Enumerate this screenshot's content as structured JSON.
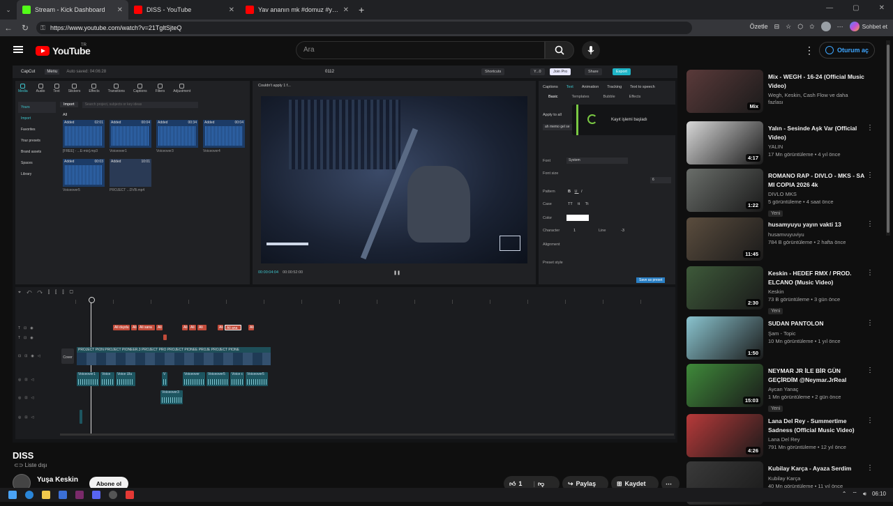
{
  "browser": {
    "tabs": [
      {
        "title": "Stream - Kick Dashboard",
        "icon": "kick-icon",
        "color": "#53fc18",
        "active": true
      },
      {
        "title": "DISS - YouTube",
        "icon": "youtube-icon",
        "color": "#ff0000",
        "active": false
      },
      {
        "title": "Yav ananın mk #domuz #yaw #ana",
        "icon": "youtube-icon",
        "color": "#ff0000",
        "active": false
      }
    ],
    "url": "https://www.youtube.com/watch?v=21TgltSjteQ",
    "summarize_label": "Özetle",
    "chat_label": "Sohbet et"
  },
  "youtube": {
    "logo_text": "YouTube",
    "region": "TR",
    "search_placeholder": "Ara",
    "signin_label": "Oturum aç"
  },
  "capcut": {
    "app_name": "CapCut",
    "menu_label": "Menu",
    "autosave": "Auto saved: 04:06:28",
    "project_name": "0112",
    "shortcuts": "Shortcuts",
    "user": "Y...0",
    "join_pro": "Join Pro",
    "share": "Share",
    "export": "Export",
    "toolbar": [
      "Media",
      "Audio",
      "Text",
      "Stickers",
      "Effects",
      "Transitions",
      "Captions",
      "Filters",
      "Adjustment"
    ],
    "sidebar": [
      "Yours",
      "Import",
      "Favorites",
      "Your presets",
      "Brand assets",
      "Spaces",
      "Library"
    ],
    "import_label": "Import",
    "search_placeholder": "Search project, subjects or key ideas",
    "all_label": "All",
    "media": [
      {
        "label": "Added",
        "duration": "02:01",
        "name": "[FREE] - ...E-mix].mp3"
      },
      {
        "label": "Added",
        "duration": "00:04",
        "name": "Voiceover1"
      },
      {
        "label": "Added",
        "duration": "00:34",
        "name": "Voiceover3"
      },
      {
        "label": "Added",
        "duration": "00:04",
        "name": "Voiceover4"
      },
      {
        "label": "Added",
        "duration": "00:03",
        "name": "Voiceover5"
      },
      {
        "label": "Added",
        "duration": "10:01",
        "name": "PROJECT ...DVB.mp4"
      }
    ],
    "preview_status": "Couldn't apply 1 f...",
    "time_current": "00:00:04:04",
    "time_total": "00:00:52:00",
    "props_tabs": [
      "Captions",
      "Text",
      "Animation",
      "Tracking",
      "Text to speech"
    ],
    "props_sub": [
      "Basic",
      "Templates",
      "Bubble",
      "Effects"
    ],
    "apply_all": "Apply to all",
    "text_sample": "ah memo gel se",
    "font_label": "Font",
    "font_value": "System",
    "fontsize_label": "Font size",
    "fontsize_value": "6",
    "pattern_label": "Pattern",
    "pattern_opts": [
      "B",
      "U",
      "I"
    ],
    "case_label": "Case",
    "case_opts": [
      "TT",
      "tt",
      "Tt"
    ],
    "color_label": "Color",
    "character_label": "Character",
    "character_value": "1",
    "line_label": "Line",
    "line_value": "-3",
    "alignment_label": "Alignment",
    "preset_label": "Preset style",
    "save_preset": "Save as preset",
    "toast": "Kayıt işlemi başladı",
    "text_clips": [
      "Ali duydu",
      "Ali",
      "Ali sana",
      "Ali",
      "Ali",
      "Ali",
      "Ali",
      "Ali",
      "Ali ana",
      "Ali"
    ],
    "video_clip_labels": "PROJECT PION  PROJECT PIONEER.3  PROJECT PRO  PROJECT PIONEE  PROJE  PROJECT PIONE",
    "audio_clips": [
      "Voiceover1",
      "Voice",
      "Voice Ulu",
      "V",
      "Voiceover",
      "Voiceover5",
      "Voice c",
      "Voiceover5"
    ],
    "audio_clip2": "Voiceover3",
    "cover_label": "Cover"
  },
  "video": {
    "title": "DISS",
    "visibility": "Liste dışı",
    "channel": "Yuşa Keskin",
    "subscribe": "Abone ol",
    "likes": "1",
    "share": "Paylaş",
    "save": "Kaydet"
  },
  "recommendations": [
    {
      "title": "Mix - WEGH - 16-24 (Official Music Video)",
      "meta1": "Wegh, Keskin, Cash Flow ve daha fazlası",
      "meta2": "",
      "badge": "Mix",
      "new": false,
      "thumb": "#5a3a3a"
    },
    {
      "title": "Yalın - Sesinde Aşk Var (Official Video)",
      "meta1": "YALIN",
      "meta2": "17 Mn görüntüleme • 4 yıl önce",
      "badge": "4:17",
      "new": false,
      "thumb": "#d8d8d8"
    },
    {
      "title": "ROMANO RAP - DIVLO - MKS - SA MI COPIA 2026 4k",
      "meta1": "DIVLO MKS",
      "meta2": "5 görüntüleme • 4 saat önce",
      "badge": "1:22",
      "new": true,
      "thumb": "#6a6e6a"
    },
    {
      "title": "husamyuyu yayın vakti 13",
      "meta1": "husamvuyuviyu",
      "meta2": "784 B görüntüleme • 2 hafta önce",
      "badge": "11:45",
      "new": false,
      "thumb": "#5b4d3e"
    },
    {
      "title": "Keskin - HEDEF RMX / PROD. ELCANO (Music Video)",
      "meta1": "Keskin",
      "meta2": "73 B görüntüleme • 3 gün önce",
      "badge": "2:30",
      "new": true,
      "thumb": "#3e5a3a"
    },
    {
      "title": "SUDAN PANTOLON",
      "meta1": "Şam - Topic",
      "meta2": "10 Mn görüntüleme • 1 yıl önce",
      "badge": "1:50",
      "new": false,
      "thumb": "#8ac4cf"
    },
    {
      "title": "NEYMAR JR İLE BİR GÜN GEÇİRDİM @Neymar.JrReal",
      "meta1": "Aycan Yanaç",
      "meta2": "1 Mn görüntüleme • 2 gün önce",
      "badge": "15:03",
      "new": true,
      "thumb": "#3f8a3a"
    },
    {
      "title": "Lana Del Rey - Summertime Sadness (Official Music Video)",
      "meta1": "Lana Del Rey",
      "meta2": "791 Mn görüntüleme • 12 yıl önce",
      "badge": "4:26",
      "new": false,
      "thumb": "#b83a3a"
    },
    {
      "title": "Kubilay Karça - Ayaza Serdim",
      "meta1": "Kubilay Karça",
      "meta2": "40 Mn görüntüleme • 11 yıl önce",
      "badge": "",
      "new": false,
      "thumb": "#3a3a3a"
    }
  ],
  "taskbar": {
    "time": "06:10"
  }
}
